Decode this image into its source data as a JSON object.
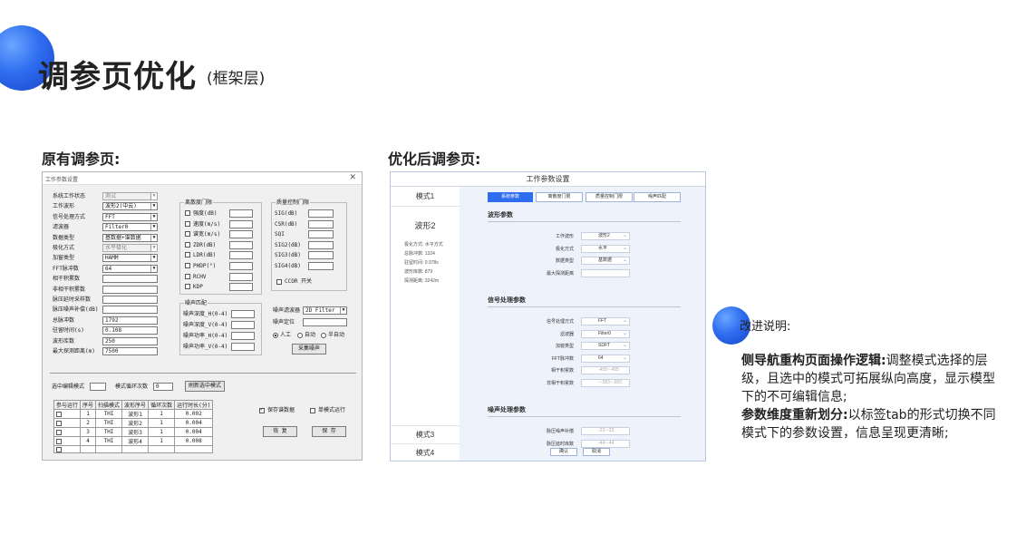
{
  "title": "调参页优化",
  "subtitle": "(框架层)",
  "old_heading": "原有调参页:",
  "new_heading": "优化后调参页:",
  "old_window": {
    "title": "工作参数设置",
    "close": "✕",
    "params": [
      {
        "label": "系统工作状态",
        "value": "测试",
        "type": "select-disabled"
      },
      {
        "label": "工作波形",
        "value": "波形2(中云)",
        "type": "select"
      },
      {
        "label": "信号处理方式",
        "value": "FFT",
        "type": "select"
      },
      {
        "label": "滤波器",
        "value": "Filter0",
        "type": "select"
      },
      {
        "label": "数据类型",
        "value": "基数据+谱数据",
        "type": "select"
      },
      {
        "label": "极化方式",
        "value": "水平极化",
        "type": "select-disabled"
      },
      {
        "label": "加窗类型",
        "value": "HAMM",
        "type": "select"
      },
      {
        "label": "FFT脉冲数",
        "value": "64",
        "type": "select"
      },
      {
        "label": "相干积累数",
        "value": "",
        "type": "input"
      },
      {
        "label": "非相干积累数",
        "value": "",
        "type": "input"
      },
      {
        "label": "脉压延时采样数",
        "value": "",
        "type": "input"
      },
      {
        "label": "脉压噪声补偿(dB)",
        "value": "",
        "type": "input"
      },
      {
        "label": "总脉冲数",
        "value": "1792",
        "type": "input"
      },
      {
        "label": "驻留时间(s)",
        "value": "0.108",
        "type": "input"
      },
      {
        "label": "波形库数",
        "value": "250",
        "type": "input"
      },
      {
        "label": "最大探测距离(m)",
        "value": "7500",
        "type": "input"
      }
    ],
    "threshold_group": {
      "title": "离散度门限",
      "items": [
        "强度(dB)",
        "速度(m/s)",
        "谱宽(m/s)",
        "ZDR(dB)",
        "LDR(dB)",
        "PHDP(°)",
        "RCHV",
        "KDP"
      ]
    },
    "quality_group": {
      "title": "质量控制门限",
      "items": [
        "SIG(dB)",
        "CSR(dB)",
        "SQI",
        "SIG2(dB)",
        "SIG3(dB)",
        "SIG4(dB)"
      ],
      "ccor_label": "CCOR 开关"
    },
    "noise_group": {
      "title": "噪声匹配",
      "items": [
        "噪声深度_H(0-4)",
        "噪声深度_V(0-4)",
        "噪声功率_H(0-4)",
        "噪声功率_V(0-4)"
      ]
    },
    "noise_filter_label": "噪声滤波器",
    "noise_filter_value": "2D Filter",
    "noise_pos_label": "噪声定位",
    "radio_manual": "人工",
    "radio_auto": "自动",
    "radio_semi": "半自动",
    "collect_noise": "采集噪声",
    "selected_edit_mode_label": "选中编辑模式",
    "loop_count_label": "模式循环次数",
    "loop_count_value": "0",
    "refresh_btn": "刷新选中模式",
    "table_headers": [
      "参与运行",
      "序号",
      "扫描模式",
      "波形序号",
      "循环次数",
      "运行时长(分)"
    ],
    "table_rows": [
      [
        "",
        "1",
        "THI",
        "波形1",
        "1",
        "0.002"
      ],
      [
        "",
        "2",
        "THI",
        "波形2",
        "1",
        "0.004"
      ],
      [
        "",
        "3",
        "THI",
        "波形3",
        "1",
        "0.004"
      ],
      [
        "",
        "4",
        "THI",
        "波形4",
        "1",
        "0.008"
      ],
      [
        "",
        "",
        "",
        "",
        "",
        ""
      ]
    ],
    "save_spectrum": "保存谱数据",
    "single_mode": "单模式运行",
    "restore_btn": "恢 复",
    "save_btn": "保 存"
  },
  "new_window": {
    "title": "工作参数设置",
    "modes": [
      "模式1",
      "波形2",
      "模式3",
      "模式4"
    ],
    "mode_info": [
      "极化方式: 水平方式",
      "总脉冲数: 1324",
      "驻留时间: 0.978s",
      "波形库数: 879",
      "探测距离: 3242m"
    ],
    "tabs": [
      "系统参数",
      "离散度门限",
      "质量控制门限",
      "噪声匹配"
    ],
    "sections": [
      {
        "title": "波形参数",
        "fields": [
          {
            "label": "工作波形",
            "value": "波形2"
          },
          {
            "label": "极化方式",
            "value": "水平"
          },
          {
            "label": "数据类型",
            "value": "基数据"
          },
          {
            "label": "最大探测距离",
            "value": ""
          }
        ]
      },
      {
        "title": "信号处理参数",
        "fields": [
          {
            "label": "信号处理方式",
            "value": "FFT"
          },
          {
            "label": "滤波器",
            "value": "Filter0"
          },
          {
            "label": "加窗类型",
            "value": "SDFT"
          },
          {
            "label": "FFT脉冲数",
            "value": "64"
          },
          {
            "label": "相干积累数",
            "value": "-455~-455"
          },
          {
            "label": "非相干积累数",
            "value": "-~583~-583"
          }
        ]
      },
      {
        "title": "噪声处理参数",
        "fields": [
          {
            "label": "脉压噪声补偿",
            "value": "-23~-23"
          },
          {
            "label": "脉压延时库数",
            "value": "-44~-44"
          }
        ]
      }
    ],
    "confirm": "确认",
    "cancel": "取消"
  },
  "notes": {
    "title": "改进说明:",
    "point1_head": "侧导航重构页面操作逻辑:",
    "point1_body": "调整模式选择的层级，且选中的模式可拓展纵向高度，显示模型下的不可编辑信息;",
    "point2_head": "参数维度重新划分:",
    "point2_body": "以标签tab的形式切换不同模式下的参数设置，信息呈现更清晰;"
  },
  "colors": {
    "accent": "#2f6df0",
    "panel_bg": "#eef3fb"
  }
}
